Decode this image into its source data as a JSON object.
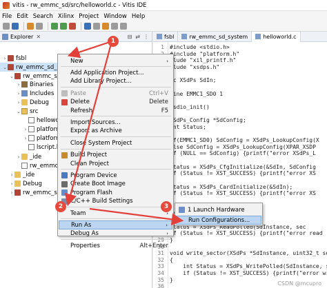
{
  "window": {
    "title": "vitis - rw_emmc_sd/src/helloworld.c - Vitis IDE"
  },
  "menubar": [
    "File",
    "Edit",
    "Search",
    "Xilinx",
    "Project",
    "Window",
    "Help"
  ],
  "explorer": {
    "title": "Explorer",
    "close": "✕",
    "tree": [
      {
        "label": "fsbl",
        "indent": 0,
        "icon": "proj",
        "twisty": "›"
      },
      {
        "label": "rw_emmc_sd_sys",
        "indent": 0,
        "icon": "proj",
        "twisty": "⌄",
        "selected": true
      },
      {
        "label": "rw_emmc_sd",
        "indent": 1,
        "icon": "proj",
        "twisty": "⌄"
      },
      {
        "label": "Binaries",
        "indent": 2,
        "icon": "bin",
        "twisty": "›"
      },
      {
        "label": "Includes",
        "indent": 2,
        "icon": "inc",
        "twisty": "›"
      },
      {
        "label": "Debug",
        "indent": 2,
        "icon": "folder",
        "twisty": "›"
      },
      {
        "label": "src",
        "indent": 2,
        "icon": "src",
        "twisty": "⌄"
      },
      {
        "label": "helloworl",
        "indent": 3,
        "icon": "file",
        "twisty": ""
      },
      {
        "label": "platforn",
        "indent": 3,
        "icon": "file",
        "twisty": "›"
      },
      {
        "label": "platforn",
        "indent": 3,
        "icon": "file",
        "twisty": "›"
      },
      {
        "label": "lscript.l",
        "indent": 3,
        "icon": "file",
        "twisty": ""
      },
      {
        "label": "_ide",
        "indent": 2,
        "icon": "folder",
        "twisty": "›"
      },
      {
        "label": "rw_emmc_sd",
        "indent": 2,
        "icon": "file",
        "twisty": ""
      },
      {
        "label": "_ide",
        "indent": 1,
        "icon": "folder",
        "twisty": "›"
      },
      {
        "label": "Debug",
        "indent": 1,
        "icon": "folder",
        "twisty": "›"
      },
      {
        "label": "rw_emmc_sd",
        "indent": 1,
        "icon": "proj",
        "twisty": "›"
      }
    ]
  },
  "editor": {
    "tabs": [
      "fsbl",
      "rw_emmc_sd_system",
      "helloworld.c"
    ],
    "lines": [
      {
        "n": "1",
        "t": "#include <stdio.h>"
      },
      {
        "n": "2",
        "t": "#include \"platform.h\""
      },
      {
        "n": "",
        "t": "clude \"xil_printf.h\""
      },
      {
        "n": "",
        "t": "clude \"xsdps.h\""
      },
      {
        "n": "",
        "t": ""
      },
      {
        "n": "",
        "t": "ic XSdPs SdIn;"
      },
      {
        "n": "",
        "t": ""
      },
      {
        "n": "",
        "t": "fine EMMC1_SD0 1"
      },
      {
        "n": "",
        "t": ""
      },
      {
        "n": "",
        "t": " sdio_init()"
      },
      {
        "n": "",
        "t": ""
      },
      {
        "n": "",
        "t": "XSdPs_Config *SdConfig;"
      },
      {
        "n": "",
        "t": "int Status;"
      },
      {
        "n": "",
        "t": ""
      },
      {
        "n": "",
        "t": "if(EMMC1_SD0) SdConfig = XSdPs_LookupConfig(X"
      },
      {
        "n": "",
        "t": "else SdConfig = XSdPs_LookupConfig(XPAR_XSDP"
      },
      {
        "n": "",
        "t": "if (NULL == SdConfig) {printf(\"error XSdPs_L"
      },
      {
        "n": "",
        "t": ""
      },
      {
        "n": "",
        "t": "Status = XSdPs_CfgInitialize(&SdIn, SdConfig"
      },
      {
        "n": "",
        "t": "if (Status != XST_SUCCESS) {printf(\"error XS"
      },
      {
        "n": "",
        "t": ""
      },
      {
        "n": "",
        "t": "Status = XSdPs_CardInitialize(&SdIn);"
      },
      {
        "n": "",
        "t": "if (Status != XST_SUCCESS) {printf(\"error XS"
      },
      {
        "n": "",
        "t": ""
      },
      {
        "n": "",
        "t": ""
      },
      {
        "n": "",
        "t": "nstance, uint32_t sec"
      },
      {
        "n": "",
        "t": ""
      },
      {
        "n": "",
        "t": "Status = XSdPs_ReadPolled(SdInstance, sec"
      },
      {
        "n": "",
        "t": "if (Status != XST_SUCCESS) {printf(\"error read"
      },
      {
        "n": "29",
        "t": "}"
      },
      {
        "n": "30",
        "t": ""
      },
      {
        "n": "31",
        "t": "void write_sector(XSdPs *SdInstance, uint32_t se"
      },
      {
        "n": "32",
        "t": "{"
      },
      {
        "n": "33",
        "t": "    int Status = XSdPs_WritePolled(SdInstance, se"
      },
      {
        "n": "34",
        "t": "    if (Status != XST_SUCCESS) {printf(\"error wri"
      },
      {
        "n": "35",
        "t": "}"
      },
      {
        "n": "36",
        "t": ""
      }
    ]
  },
  "context_menu": {
    "items": [
      {
        "label": "New",
        "shortcut": "",
        "arrow": "›",
        "icon": "",
        "disabled": false
      },
      {
        "sep": true
      },
      {
        "label": "Add Application Project...",
        "shortcut": "",
        "icon": "",
        "disabled": false
      },
      {
        "label": "Add Library Project...",
        "shortcut": "",
        "icon": "",
        "disabled": false
      },
      {
        "sep": true
      },
      {
        "label": "Paste",
        "shortcut": "Ctrl+V",
        "icon": "paste",
        "disabled": true
      },
      {
        "label": "Delete",
        "shortcut": "Delete",
        "icon": "delete",
        "disabled": false
      },
      {
        "label": "Refresh",
        "shortcut": "F5",
        "icon": "",
        "disabled": false
      },
      {
        "sep": true
      },
      {
        "label": "Import Sources...",
        "shortcut": "",
        "icon": "",
        "disabled": false
      },
      {
        "label": "Export as Archive",
        "shortcut": "",
        "icon": "",
        "disabled": false
      },
      {
        "sep": true
      },
      {
        "label": "Close System Project",
        "shortcut": "",
        "icon": "",
        "disabled": false
      },
      {
        "sep": true
      },
      {
        "label": "Build Project",
        "shortcut": "",
        "icon": "build",
        "disabled": false
      },
      {
        "label": "Clean Project",
        "shortcut": "",
        "icon": "",
        "disabled": false
      },
      {
        "sep": true
      },
      {
        "label": "Program Device",
        "shortcut": "",
        "icon": "device",
        "disabled": false
      },
      {
        "label": "Create Boot Image",
        "shortcut": "",
        "icon": "boot",
        "disabled": false
      },
      {
        "label": "Program Flash",
        "shortcut": "",
        "icon": "flash",
        "disabled": false
      },
      {
        "label": "C/C++ Build Settings",
        "shortcut": "",
        "icon": "settings",
        "disabled": false
      },
      {
        "sep": true
      },
      {
        "label": "Team",
        "shortcut": "",
        "arrow": "›",
        "icon": "",
        "disabled": false
      },
      {
        "sep": true
      },
      {
        "label": "Run As",
        "shortcut": "",
        "arrow": "›",
        "icon": "",
        "disabled": false,
        "highlight": true
      },
      {
        "label": "Debug As",
        "shortcut": "",
        "arrow": "›",
        "icon": "",
        "disabled": false
      },
      {
        "sep": true
      },
      {
        "label": "Properties",
        "shortcut": "Alt+Enter",
        "icon": "",
        "disabled": false
      }
    ]
  },
  "submenu": {
    "items": [
      {
        "label": "1 Launch Hardware",
        "icon": "launch"
      },
      {
        "label": "Run Configurations...",
        "icon": "",
        "highlight": true
      }
    ]
  },
  "annotations": {
    "badges": [
      "1",
      "2",
      "3"
    ],
    "arrow_color": "#e2403a"
  },
  "watermark": "CSDN @mcupro",
  "colors": {
    "selection": "#cde3f7",
    "menu_highlight": "#bcd6f2",
    "badge": "#e64a3c"
  }
}
